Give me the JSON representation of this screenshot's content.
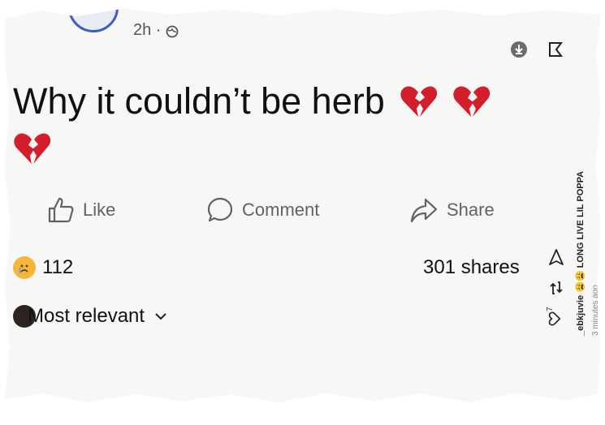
{
  "post": {
    "time": "2h ·",
    "text": "Why it couldn’t be herb",
    "emoji_count": 3
  },
  "actions": {
    "like": "Like",
    "comment": "Comment",
    "share": "Share"
  },
  "stats": {
    "reactions": "112",
    "shares": "301 shares"
  },
  "sort": {
    "label": "Most relevant"
  },
  "side": {
    "username": "_ebkjuvie",
    "caption": "LONG LIVE LIL POPPA",
    "time": "3 minutes ago",
    "likes": "7"
  },
  "colors": {
    "avatar_ring": "#3b5fc0",
    "heart": "#d21f2b",
    "text": "#111111",
    "muted": "#5f6268"
  }
}
